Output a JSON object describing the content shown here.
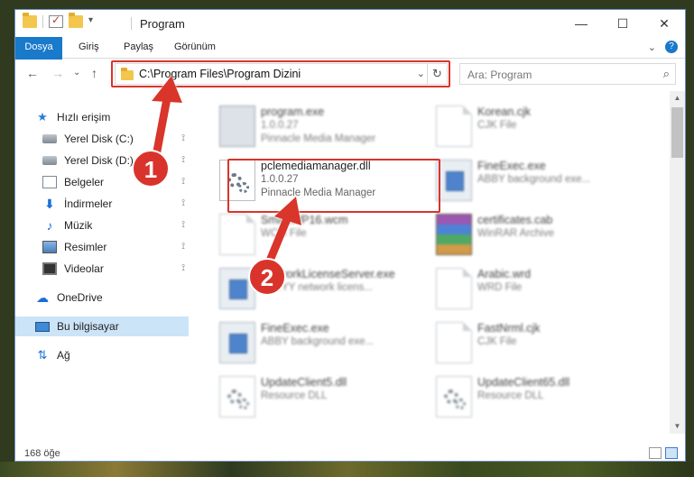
{
  "window": {
    "title": "Program",
    "min_label": "—",
    "max_label": "☐",
    "close_label": "✕"
  },
  "ribbon": {
    "tabs": [
      "Dosya",
      "Giriş",
      "Paylaş",
      "Görünüm"
    ],
    "expand_label": "⌄",
    "help_label": "?"
  },
  "nav": {
    "back": "←",
    "forward": "→",
    "recent": "⌄",
    "up": "↑",
    "address": "C:\\Program Files\\Program Dizini",
    "dropdown": "⌄",
    "refresh": "↻",
    "search_placeholder": "Ara: Program",
    "search_icon": "⌕"
  },
  "sidebar": {
    "items": [
      {
        "label": "Hızlı erişim",
        "icon": "star-icon"
      },
      {
        "label": "Yerel Disk (C:)",
        "icon": "disk-icon",
        "pinned": true
      },
      {
        "label": "Yerel Disk (D:)",
        "icon": "disk-icon",
        "pinned": true
      },
      {
        "label": "Belgeler",
        "icon": "document-icon",
        "pinned": true
      },
      {
        "label": "İndirmeler",
        "icon": "download-icon",
        "pinned": true
      },
      {
        "label": "Müzik",
        "icon": "music-icon",
        "pinned": true
      },
      {
        "label": "Resimler",
        "icon": "pictures-icon",
        "pinned": true
      },
      {
        "label": "Videolar",
        "icon": "video-icon",
        "pinned": true
      },
      {
        "label": "OneDrive",
        "icon": "cloud-icon"
      },
      {
        "label": "Bu bilgisayar",
        "icon": "computer-icon",
        "selected": true
      },
      {
        "label": "Ağ",
        "icon": "network-icon"
      }
    ],
    "pin_glyph": "📌"
  },
  "files": [
    {
      "name": "program.exe",
      "line1": "1.0.0.27",
      "line2": "Pinnacle Media Manager",
      "thumb": "app",
      "blurred": true
    },
    {
      "name": "Korean.cjk",
      "line1": "CJK File",
      "line2": "",
      "thumb": "page",
      "blurred": true
    },
    {
      "name": "pclemediamanager.dll",
      "line1": "1.0.0.27",
      "line2": "Pinnacle Media Manager",
      "thumb": "gear",
      "blurred": false
    },
    {
      "name": "FineExec.exe",
      "line1": "ABBY background exe...",
      "line2": "",
      "thumb": "exe",
      "blurred": true
    },
    {
      "name": "SmartWP16.wcm",
      "line1": "WCM File",
      "line2": "",
      "thumb": "page",
      "blurred": true
    },
    {
      "name": "certificates.cab",
      "line1": "WinRAR Archive",
      "line2": "",
      "thumb": "rar",
      "blurred": true
    },
    {
      "name": "NetworkLicenseServer.exe",
      "line1": "ABBYY network licens...",
      "line2": "",
      "thumb": "exe",
      "blurred": true
    },
    {
      "name": "Arabic.wrd",
      "line1": "WRD File",
      "line2": "",
      "thumb": "page",
      "blurred": true
    },
    {
      "name": "FineExec.exe",
      "line1": "ABBY background exe...",
      "line2": "",
      "thumb": "exe",
      "blurred": true
    },
    {
      "name": "FastNrml.cjk",
      "line1": "CJK File",
      "line2": "",
      "thumb": "page",
      "blurred": true
    },
    {
      "name": "UpdateClient5.dll",
      "line1": "Resource DLL",
      "line2": "",
      "thumb": "gear",
      "blurred": true
    },
    {
      "name": "UpdateClient65.dll",
      "line1": "Resource DLL",
      "line2": "",
      "thumb": "gear",
      "blurred": true
    }
  ],
  "status": {
    "count": "168 öğe"
  },
  "callouts": [
    {
      "label": "1"
    },
    {
      "label": "2"
    }
  ],
  "colors": {
    "accent": "#1979ca",
    "highlight": "#d9342b",
    "selected": "#cce4f7"
  }
}
